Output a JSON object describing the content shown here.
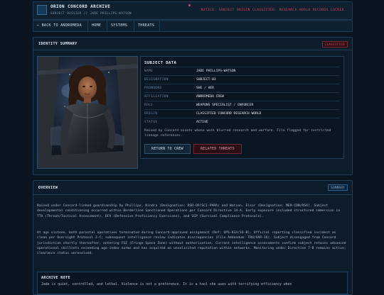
{
  "header": {
    "title": "ORION CONCORD ARCHIVE",
    "subtitle": "SUBJECT DOSSIER // JADE PHILLIPS-WATSON",
    "notice": "NOTICE: SUBJECT ORIGIN CLASSIFIED. RESEARCH-WORLD RECORDS LOCKED."
  },
  "nav": {
    "items": [
      "← BACK TO ANDROMEDA",
      "HOME",
      "SYSTEMS",
      "THREATS"
    ]
  },
  "identity": {
    "title": "IDENTITY SUMMARY",
    "badge": "CLASSIFIED"
  },
  "subject": {
    "title": "SUBJECT DATA",
    "rows": [
      {
        "label": "NAME",
        "value": "JADE PHILLIPS-WATSON"
      },
      {
        "label": "DESIGNATION",
        "value": "SUBJECT-03"
      },
      {
        "label": "PRONOUNS",
        "value": "SHE / HER"
      },
      {
        "label": "AFFILIATION",
        "value": "ANDROMEDA CREW"
      },
      {
        "label": "ROLE",
        "value": "WEAPONS SPECIALIST / ENFORCER"
      },
      {
        "label": "ORIGIN",
        "value": "CLASSIFIED CONCORD RESEARCH WORLD"
      },
      {
        "label": "STATUS",
        "value": "ACTIVE"
      }
    ],
    "description": "Raised by Concord assets whose work blurred research and warfare. File flagged for restricted lineage references.",
    "buttons": {
      "return": "RETURN TO CREW",
      "threats": "RELATED THREATS"
    }
  },
  "overview": {
    "title": "OVERVIEW",
    "badge": "SUMMARY",
    "p1": "Raised under Concord-linked guardianship by Phillips, Kindra (Designation: RSR-OP/SCI-PARA) and Watson, Elsor (Designation: MER-CON/RSA). Subject developmental conditioning occurred within Borderline Sanctioned Operations per Concord Directive 14-A. Early exposure included structured immersion in TTA (Threat/Tactical Assessment), DFX (Defensive Proficiency Exercises), and SCP (Survival Compliance Protocols).",
    "p2": "At age sixteen, both parental operatives terminated during Concord-approved assignment (Ref: OPS-KIA/16-B). Official reporting classified incident as clean per Oversight Protocol 3-C; subsequent intelligence review indicates discrepancies (File Addendum: TRU/VAR-16). Subject disengaged from Concord jurisdiction shortly thereafter, entering FSZ (Fringe Space Zone) without authorization. Current intelligence assessments confirm subject retains advanced operational skillsets exceeding age-index norms and has acquired an unsolicited reputation within networks. Monitoring under Directive 7-B remains active; clearance status unresolved.",
    "note_title": "ARCHIVE NOTE",
    "note_text": "Jade is quiet, controlled, and lethal. Violence is not a preference. It is a tool she uses with terrifying efficiency when"
  },
  "colors": {
    "background": "#0a1520",
    "panel": "#0d1c2b",
    "border": "#1f3d58",
    "alert": "#d9485a",
    "accent": "#7db7ec"
  }
}
